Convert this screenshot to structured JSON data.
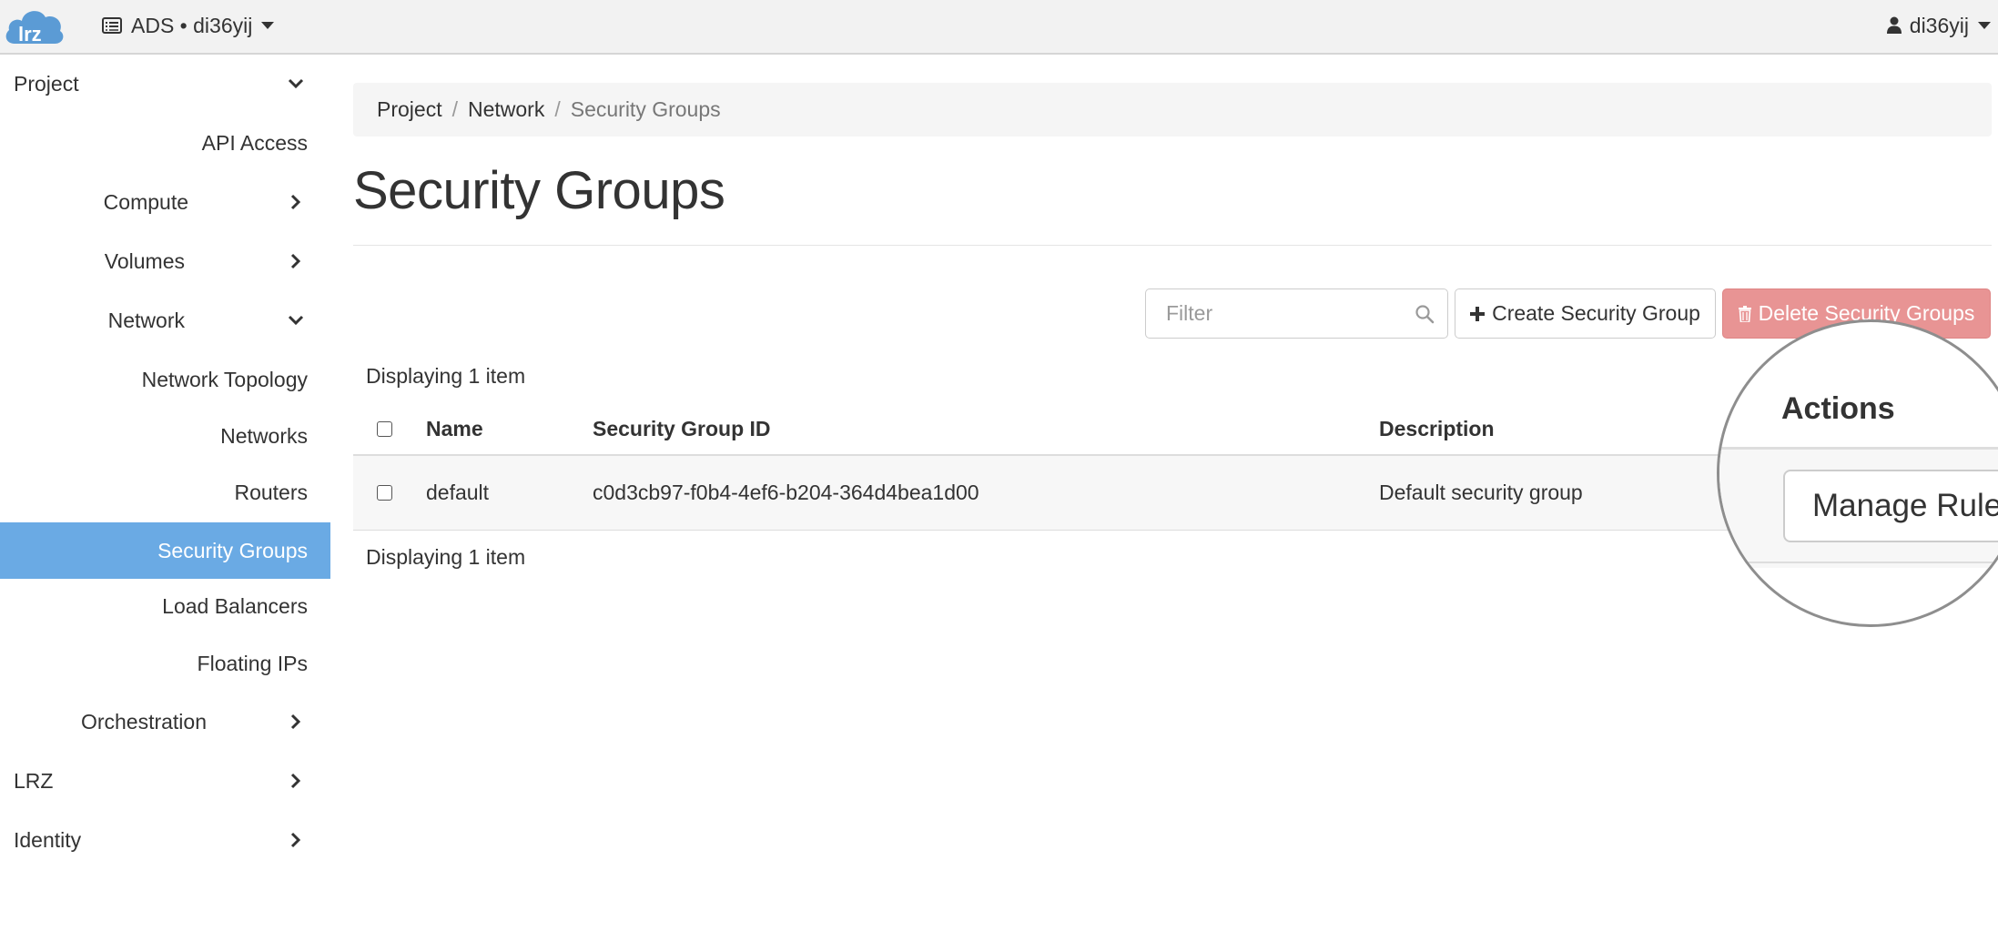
{
  "topbar": {
    "logo_text": "lrz",
    "project_switcher": "ADS • di36yij",
    "user_menu": "di36yij"
  },
  "sidebar": {
    "project": "Project",
    "api_access": "API Access",
    "compute": "Compute",
    "volumes": "Volumes",
    "network": "Network",
    "network_topology": "Network Topology",
    "networks": "Networks",
    "routers": "Routers",
    "security_groups": "Security Groups",
    "load_balancers": "Load Balancers",
    "floating_ips": "Floating IPs",
    "orchestration": "Orchestration",
    "lrz": "LRZ",
    "identity": "Identity"
  },
  "breadcrumb": {
    "project": "Project",
    "network": "Network",
    "current": "Security Groups",
    "separator": "/"
  },
  "page": {
    "title": "Security Groups"
  },
  "toolbar": {
    "filter_placeholder": "Filter",
    "create_label": "Create Security Group",
    "delete_label": "Delete Security Groups"
  },
  "table": {
    "count_top": "Displaying 1 item",
    "count_bottom": "Displaying 1 item",
    "headers": {
      "name": "Name",
      "id": "Security Group ID",
      "description": "Description",
      "actions": "Actions"
    },
    "rows": [
      {
        "name": "default",
        "id": "c0d3cb97-f0b4-4ef6-b204-364d4bea1d00",
        "description": "Default security group",
        "action": "Manage Rules"
      }
    ]
  },
  "colors": {
    "active_nav": "#6aaae4",
    "danger_button": "#e89494",
    "logo": "#5b9bd5"
  }
}
